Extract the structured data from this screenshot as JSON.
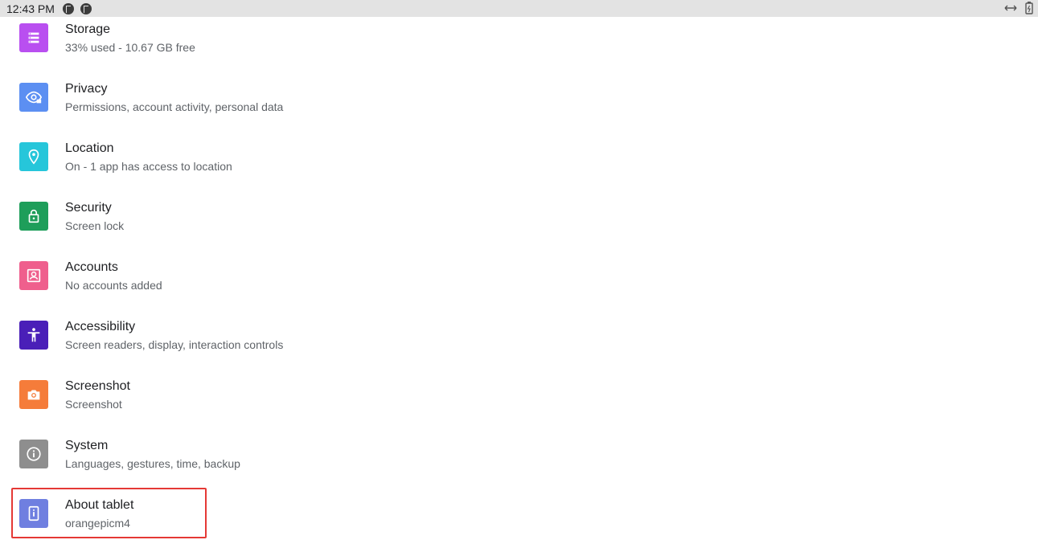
{
  "status_bar": {
    "time": "12:43 PM",
    "left_icons": [
      "notification-icon",
      "notification-icon"
    ],
    "right_icons": [
      "link-icon",
      "battery-icon"
    ]
  },
  "settings": [
    {
      "title": "Storage",
      "summary": "33% used - 10.67 GB free",
      "icon": "storage-icon",
      "color": "#b94ff0"
    },
    {
      "title": "Privacy",
      "summary": "Permissions, account activity, personal data",
      "icon": "privacy-icon",
      "color": "#5c8ff2"
    },
    {
      "title": "Location",
      "summary": "On - 1 app has access to location",
      "icon": "location-icon",
      "color": "#26c6da"
    },
    {
      "title": "Security",
      "summary": "Screen lock",
      "icon": "lock-icon",
      "color": "#1e9e5a"
    },
    {
      "title": "Accounts",
      "summary": "No accounts added",
      "icon": "account-icon",
      "color": "#ef5f8d"
    },
    {
      "title": "Accessibility",
      "summary": "Screen readers, display, interaction controls",
      "icon": "accessibility-icon",
      "color": "#4a1fb8"
    },
    {
      "title": "Screenshot",
      "summary": "Screenshot",
      "icon": "camera-icon",
      "color": "#f57c3a"
    },
    {
      "title": "System",
      "summary": "Languages, gestures, time, backup",
      "icon": "info-icon",
      "color": "#8e8e8e"
    },
    {
      "title": "About tablet",
      "summary": "orangepicm4",
      "icon": "tablet-icon",
      "color": "#6f7fe0"
    }
  ],
  "highlight_color": "#e53935"
}
